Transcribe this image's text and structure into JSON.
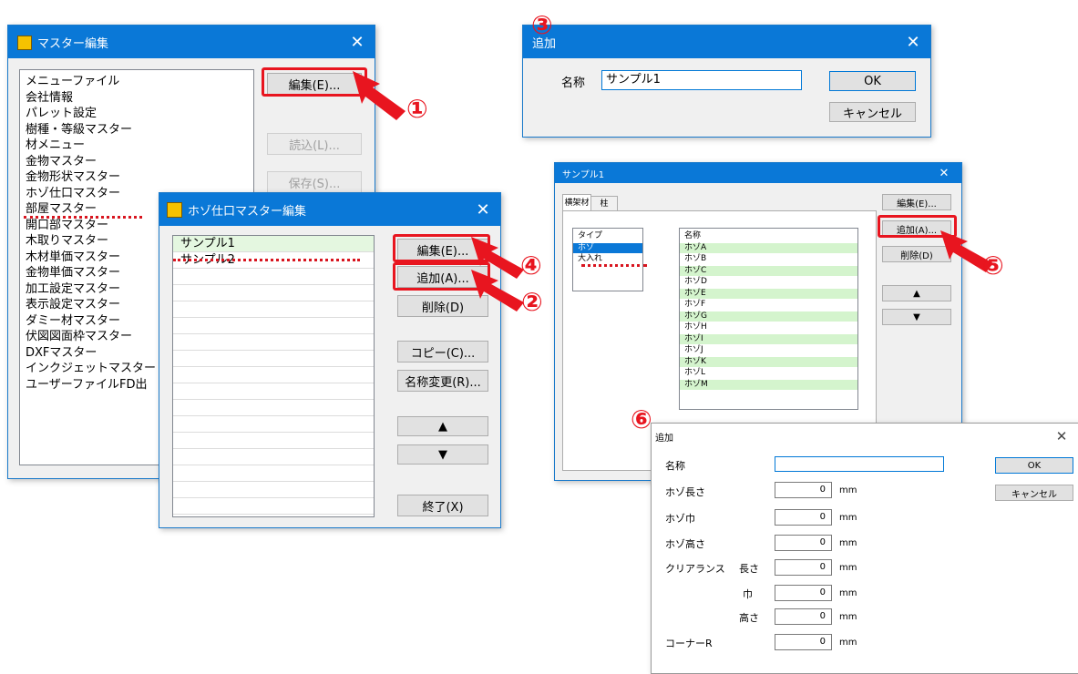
{
  "master_window": {
    "title": "マスター編集",
    "close": "✕",
    "items": [
      "メニューファイル",
      "会社情報",
      "パレット設定",
      "樹種・等級マスター",
      "材メニュー",
      "金物マスター",
      "金物形状マスター",
      "ホゾ仕口マスター",
      "部屋マスター",
      "開口部マスター",
      "木取りマスター",
      "木材単価マスター",
      "金物単価マスター",
      "加工設定マスター",
      "表示設定マスター",
      "ダミー材マスター",
      "伏図図面枠マスター",
      "DXFマスター",
      "インクジェットマスター",
      "ユーザーファイルFD出"
    ],
    "edit_button": "編集(E)...",
    "load_button": "読込(L)...",
    "save_button": "保存(S)..."
  },
  "hozo_window": {
    "title": "ホゾ仕口マスター編集",
    "close": "✕",
    "items": [
      "サンプル1",
      "サンプル2"
    ],
    "edit_button": "編集(E)...",
    "add_button": "追加(A)...",
    "delete_button": "削除(D)",
    "copy_button": "コピー(C)...",
    "rename_button": "名称変更(R)...",
    "up_button": "▲",
    "down_button": "▼",
    "exit_button": "終了(X)"
  },
  "add_dialog": {
    "title": "追加",
    "close": "✕",
    "name_label": "名称",
    "name_value": "サンプル1",
    "ok_button": "OK",
    "cancel_button": "キャンセル"
  },
  "sample_window": {
    "title": "サンプル1",
    "close": "✕",
    "tabs": [
      "横架材",
      "柱"
    ],
    "type_header": "タイプ",
    "types": [
      "ホゾ",
      "大入れ"
    ],
    "name_header": "名称",
    "names": [
      "ホゾA",
      "ホゾB",
      "ホゾC",
      "ホゾD",
      "ホゾE",
      "ホゾF",
      "ホゾG",
      "ホゾH",
      "ホゾI",
      "ホゾJ",
      "ホゾK",
      "ホゾL",
      "ホゾM"
    ],
    "edit_button": "編集(E)...",
    "add_button": "追加(A)...",
    "delete_button": "削除(D)",
    "up_button": "▲",
    "down_button": "▼"
  },
  "add_detail_dialog": {
    "title": "追加",
    "close": "✕",
    "name_label": "名称",
    "hozo_length_label": "ホゾ長さ",
    "hozo_width_label": "ホゾ巾",
    "hozo_height_label": "ホゾ高さ",
    "clearance_label": "クリアランス",
    "clear_length_label": "長さ",
    "clear_width_label": "巾",
    "clear_height_label": "高さ",
    "corner_label": "コーナーR",
    "value": "0",
    "unit": "mm",
    "ok_button": "OK",
    "cancel_button": "キャンセル"
  },
  "annotations": {
    "n1": "①",
    "n2": "②",
    "n3": "③",
    "n4": "④",
    "n5": "⑤",
    "n6": "⑥"
  },
  "colors": {
    "title_bar": "#0a78d7",
    "highlight": "#e8151f",
    "row_green": "#e4f7e0"
  }
}
